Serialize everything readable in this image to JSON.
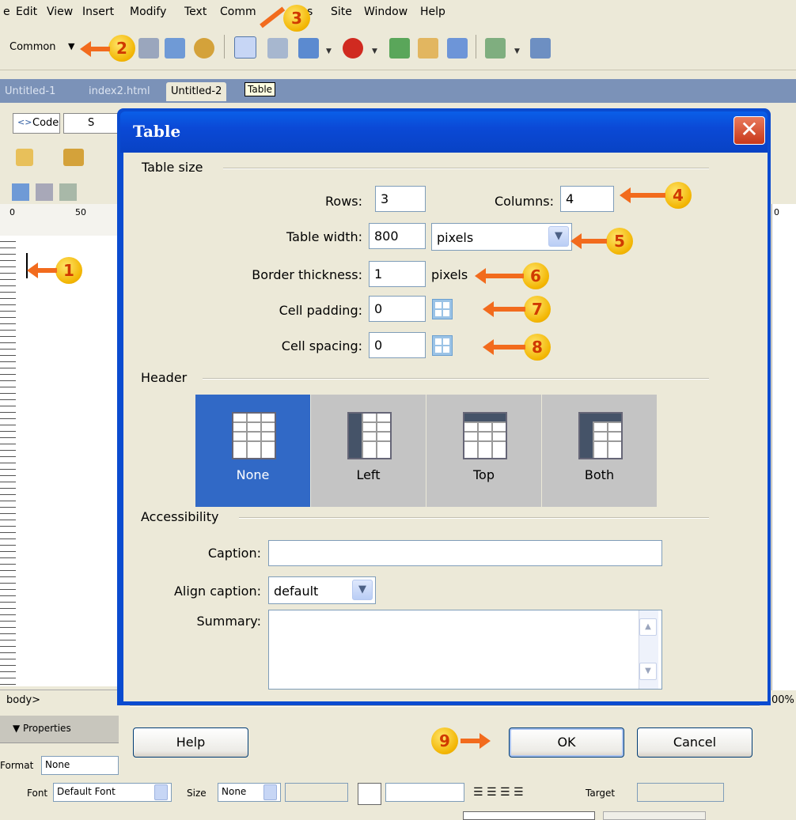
{
  "menu": [
    "e",
    "Edit",
    "View",
    "Insert",
    "Modify",
    "Text",
    "Comm",
    "s",
    "Site",
    "Window",
    "Help"
  ],
  "insert_bar": {
    "category": "Common",
    "tooltip": "Table"
  },
  "doc_tabs": [
    "Untitled-1",
    "index2.html",
    "Untitled-2"
  ],
  "view_buttons": {
    "code": "Code",
    "split_partial": "S"
  },
  "ruler": {
    "mark0": "0",
    "mark50": "50",
    "right_mark": "0"
  },
  "status": {
    "tag": "body>",
    "zoom": "00%"
  },
  "properties": {
    "title": "Properties",
    "format_label": "Format",
    "format_value": "None",
    "font_label": "Font",
    "font_value": "Default Font",
    "size_label": "Size",
    "size_value": "None",
    "target_label": "Target"
  },
  "dialog": {
    "title": "Table",
    "close": "✕",
    "table_size": {
      "heading": "Table size",
      "rows_label": "Rows:",
      "rows_value": "3",
      "columns_label": "Columns:",
      "columns_value": "4",
      "width_label": "Table width:",
      "width_value": "800",
      "width_unit": "pixels",
      "border_label": "Border thickness:",
      "border_value": "1",
      "border_unit": "pixels",
      "padding_label": "Cell padding:",
      "padding_value": "0",
      "spacing_label": "Cell spacing:",
      "spacing_value": "0"
    },
    "header": {
      "heading": "Header",
      "options": [
        {
          "label": "None",
          "selected": true
        },
        {
          "label": "Left",
          "selected": false
        },
        {
          "label": "Top",
          "selected": false
        },
        {
          "label": "Both",
          "selected": false
        }
      ]
    },
    "accessibility": {
      "heading": "Accessibility",
      "caption_label": "Caption:",
      "caption_value": "",
      "align_label": "Align caption:",
      "align_value": "default",
      "summary_label": "Summary:",
      "summary_value": ""
    },
    "buttons": {
      "help": "Help",
      "ok": "OK",
      "cancel": "Cancel"
    }
  },
  "callouts": [
    "1",
    "2",
    "3",
    "4",
    "5",
    "6",
    "7",
    "8",
    "9"
  ],
  "colors": {
    "title_bar": "#0b49d6",
    "selected_option": "#3169c6",
    "callout": "#f2b400",
    "arrow": "#f26b1d"
  }
}
